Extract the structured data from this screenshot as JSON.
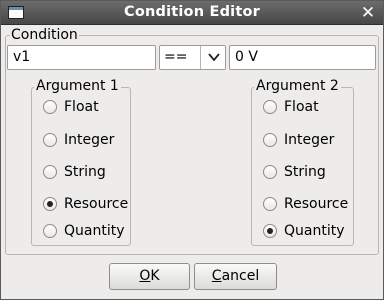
{
  "window": {
    "title": "Condition Editor",
    "close_glyph": "✕"
  },
  "condition": {
    "label": "Condition",
    "left_value": "v1",
    "operator": "==",
    "right_value": "0 V"
  },
  "argument1": {
    "label": "Argument 1",
    "options": [
      "Float",
      "Integer",
      "String",
      "Resource",
      "Quantity"
    ],
    "selected": "Resource"
  },
  "argument2": {
    "label": "Argument 2",
    "options": [
      "Float",
      "Integer",
      "String",
      "Resource",
      "Quantity"
    ],
    "selected": "Quantity"
  },
  "buttons": {
    "ok_mnemonic": "O",
    "ok_rest": "K",
    "cancel_mnemonic": "C",
    "cancel_rest": "ancel"
  },
  "icons": {
    "window": "window-icon",
    "close": "close-icon",
    "dropdown": "chevron-down-icon"
  }
}
